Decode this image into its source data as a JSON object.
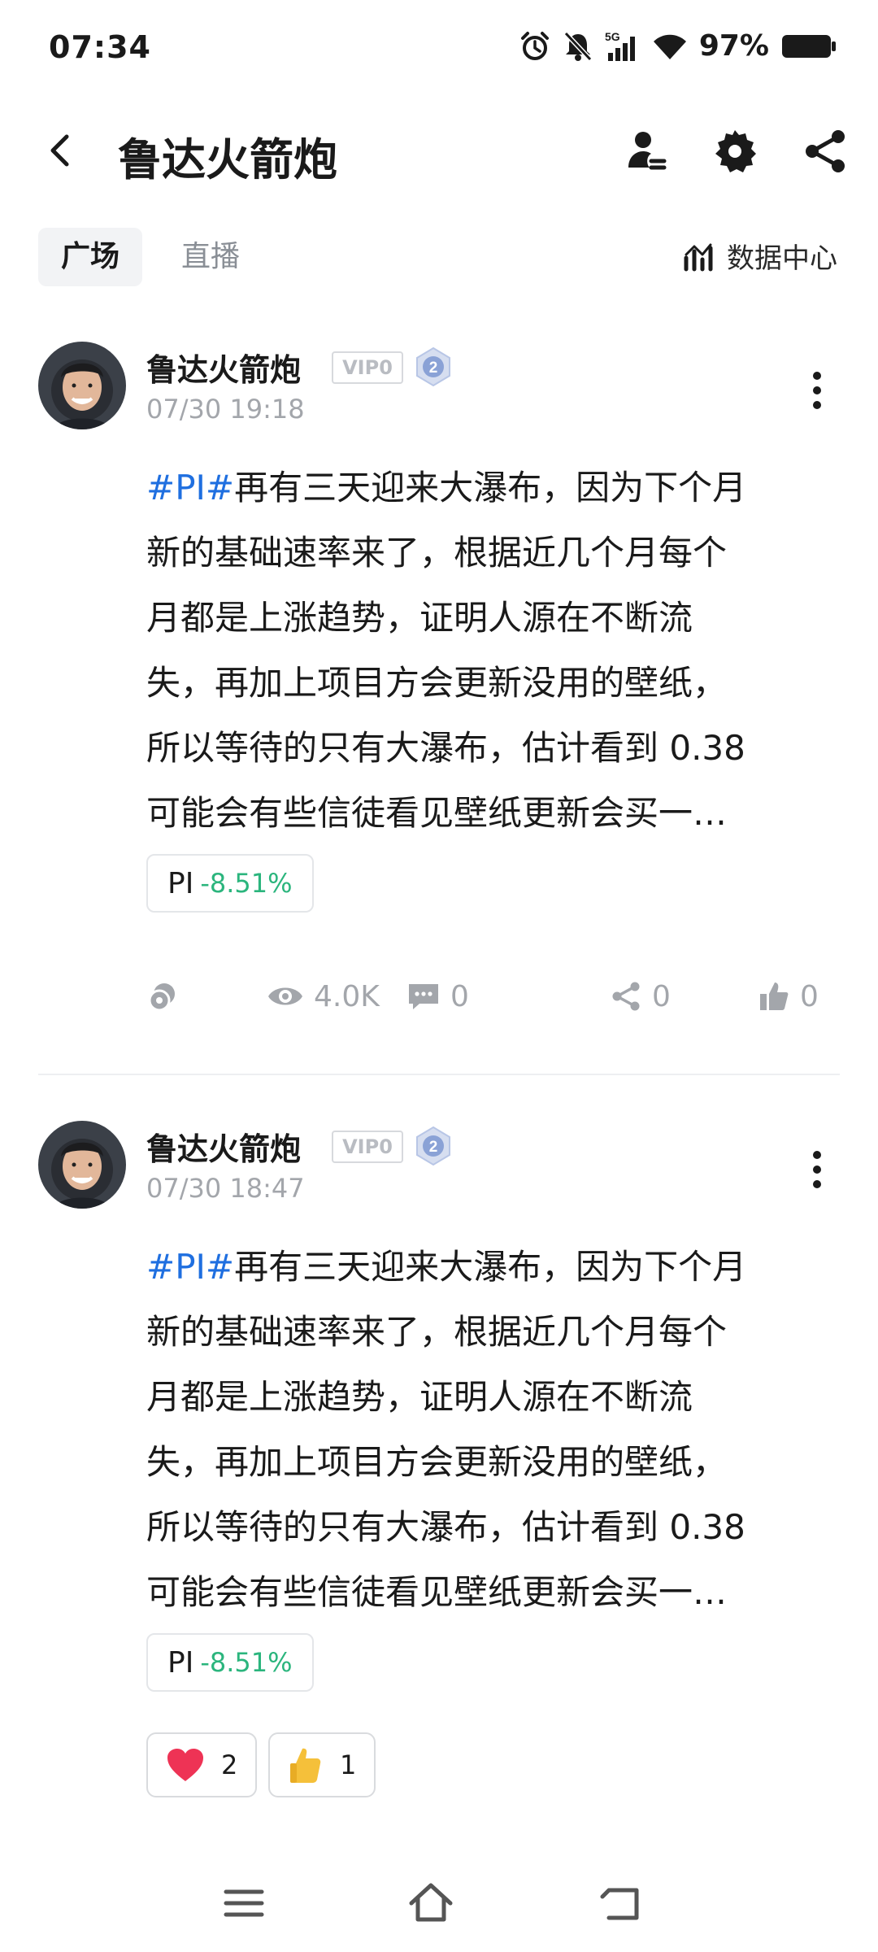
{
  "status_bar": {
    "time": "07:34",
    "battery_percent": "97%",
    "network_label": "5G",
    "icons": [
      "alarm-icon",
      "bell-off-icon",
      "signal-5g-icon",
      "wifi-icon",
      "battery-icon"
    ]
  },
  "header": {
    "title": "鲁达火箭炮",
    "icons": [
      "back-icon",
      "user-manage-icon",
      "gear-icon",
      "share-icon"
    ]
  },
  "tabs": {
    "items": [
      {
        "label": "广场",
        "active": true
      },
      {
        "label": "直播",
        "active": false
      }
    ],
    "data_center_label": "数据中心"
  },
  "posts": [
    {
      "author": "鲁达火箭炮",
      "vip_label": "VIP0",
      "level": "2",
      "time": "07/30 19:18",
      "hashtag": "#PI#",
      "lines": [
        "再有三天迎来大瀑布，因为下个月",
        "新的基础速率来了，根据近几个月每个",
        "月都是上涨趋势，证明人源在不断流",
        "失，再加上项目方会更新没用的壁纸，",
        "所以等待的只有大瀑布，估计看到 0.38",
        "可能会有些信徒看见壁纸更新会买一…"
      ],
      "coin": {
        "name": "PI",
        "change": "-8.51%"
      },
      "stats": {
        "views": "4.0K",
        "comments": "0",
        "shares": "0",
        "likes": "0"
      }
    },
    {
      "author": "鲁达火箭炮",
      "vip_label": "VIP0",
      "level": "2",
      "time": "07/30 18:47",
      "hashtag": "#PI#",
      "lines": [
        "再有三天迎来大瀑布，因为下个月",
        "新的基础速率来了，根据近几个月每个",
        "月都是上涨趋势，证明人源在不断流",
        "失，再加上项目方会更新没用的壁纸，",
        "所以等待的只有大瀑布，估计看到 0.38",
        "可能会有些信徒看见壁纸更新会买一…"
      ],
      "coin": {
        "name": "PI",
        "change": "-8.51%"
      },
      "reactions": [
        {
          "icon": "heart-icon",
          "count": "2"
        },
        {
          "icon": "thumbs-up-icon",
          "count": "1"
        }
      ]
    }
  ],
  "colors": {
    "hashtag": "#1f6fe0",
    "price_change": "#2bb57d",
    "muted_text": "#a3a6ab"
  }
}
